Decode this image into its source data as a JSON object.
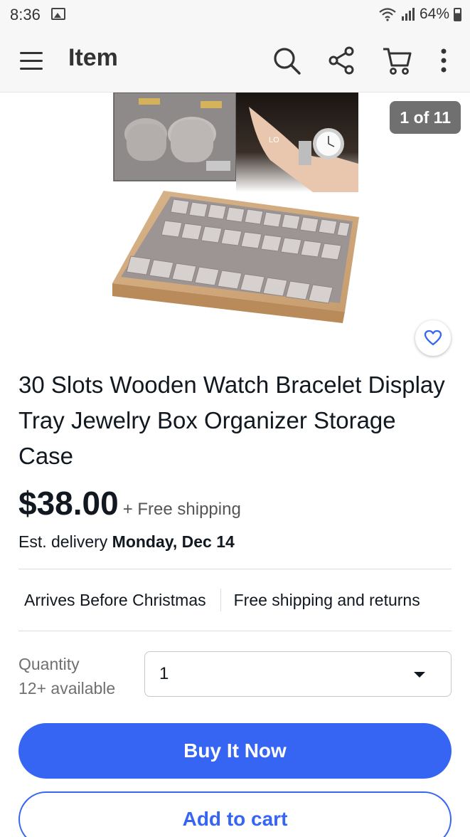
{
  "status_bar": {
    "time": "8:36",
    "battery": "64%",
    "icons": [
      "gallery-icon",
      "wifi-icon",
      "signal-icon",
      "battery-icon"
    ]
  },
  "app_bar": {
    "title": "Item",
    "icons": [
      "menu-icon",
      "search-icon",
      "share-icon",
      "cart-icon",
      "more-vert-icon"
    ]
  },
  "gallery": {
    "counter": "1 of 11",
    "watermark_text": "LO",
    "favorite_icon": "heart-outline-icon"
  },
  "product": {
    "title": "30 Slots Wooden Watch Bracelet Display Tray Jewelry Box Organizer Storage Case",
    "price": "$38.00",
    "shipping": "+ Free shipping",
    "delivery_prefix": "Est. delivery",
    "delivery_date": "Monday, Dec 14"
  },
  "badges": [
    "Arrives Before Christmas",
    "Free shipping and returns"
  ],
  "quantity": {
    "label": "Quantity",
    "available": "12+ available",
    "selected": "1"
  },
  "actions": {
    "buy_now": "Buy It Now",
    "add_to_cart": "Add to cart"
  },
  "colors": {
    "primary": "#3665f3",
    "text": "#111820",
    "counter_bg": "#707070"
  }
}
